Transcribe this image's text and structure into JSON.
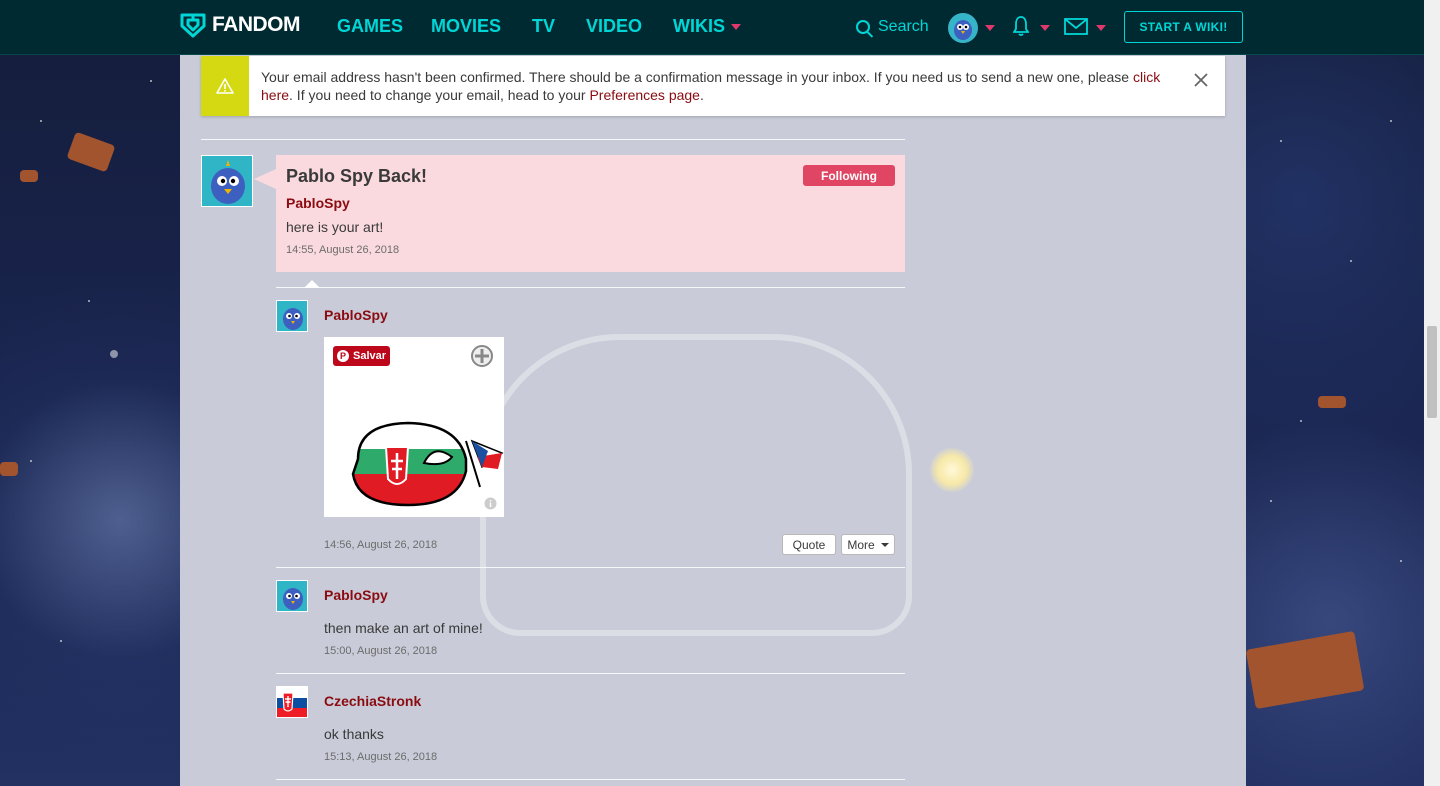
{
  "nav": {
    "logo_text": "FANDOM",
    "links": [
      "GAMES",
      "MOVIES",
      "TV",
      "VIDEO",
      "WIKIS"
    ],
    "search_label": "Search",
    "start_wiki": "START A WIKI!"
  },
  "notice": {
    "text_before": "Your email address hasn't been confirmed. There should be a confirmation message in your inbox. If you need us to send a new one, please ",
    "link1": "click here",
    "text_middle": ". If you need to change your email, head to your ",
    "link2": "Preferences page",
    "text_after": "."
  },
  "thread": {
    "title": "Pablo Spy Back!",
    "follow_label": "Following",
    "author": "PabloSpy",
    "body": "here is your art!",
    "timestamp": "14:55, August 26, 2018"
  },
  "replies": [
    {
      "author": "PabloSpy",
      "pin_label": "Salvar",
      "timestamp": "14:56, August 26, 2018",
      "quote_label": "Quote",
      "more_label": "More"
    },
    {
      "author": "PabloSpy",
      "body": "then make an art of mine!",
      "timestamp": "15:00, August 26, 2018"
    },
    {
      "author": "CzechiaStronk",
      "body": "ok thanks",
      "timestamp": "15:13, August 26, 2018"
    }
  ],
  "colors": {
    "nav_bg": "#002a32",
    "nav_link": "#00d6d6",
    "accent_pink": "#e04663",
    "user_link": "#8a0b10",
    "notice_strip": "#d4d912",
    "op_box": "#fadadf"
  }
}
